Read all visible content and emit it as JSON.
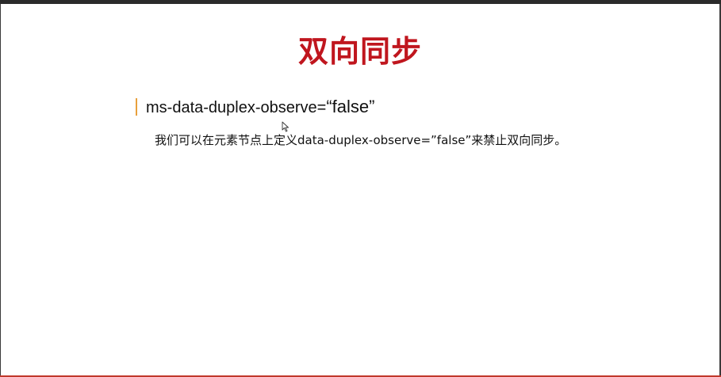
{
  "slide": {
    "title": "双向同步",
    "bullet": {
      "prefix": "ms-data-duplex-observe=",
      "value": "“false”"
    },
    "body": "我们可以在元素节点上定义data-duplex-observe=”false”来禁止双向同步。"
  },
  "colors": {
    "title": "#c0161e",
    "bullet_bar": "#e8a03c",
    "text": "#111111"
  },
  "icons": {
    "pointer": "mouse-pointer-icon"
  }
}
